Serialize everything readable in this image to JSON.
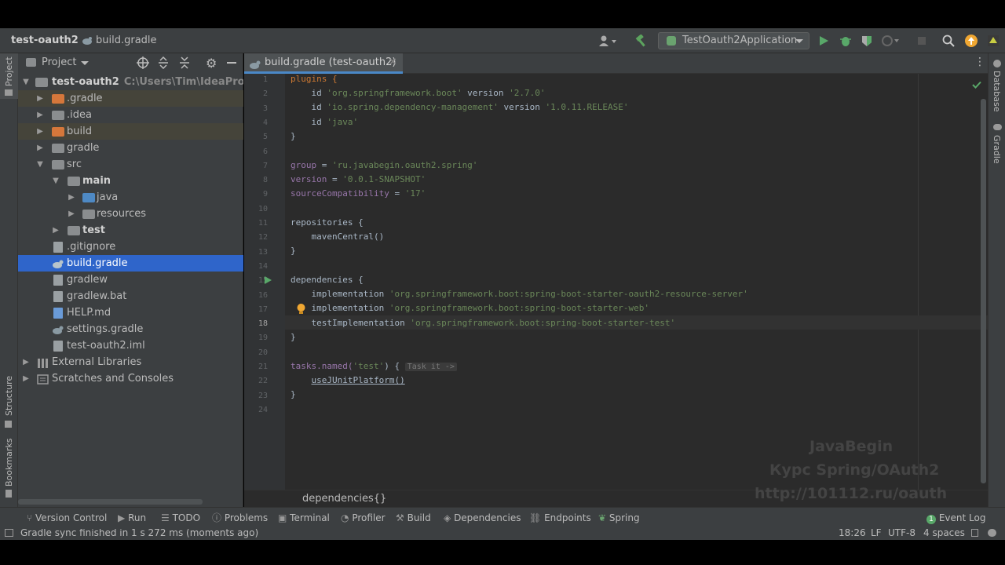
{
  "topbar": {
    "project_name": "test-oauth2",
    "file_breadcrumb": "build.gradle",
    "run_config": "TestOauth2Application"
  },
  "left_strip": {
    "project_tab": "Project",
    "structure_tab": "Structure",
    "bookmarks_tab": "Bookmarks"
  },
  "right_strip": {
    "database_tab": "Database",
    "gradle_tab": "Gradle"
  },
  "project_panel": {
    "view_selector": "Project",
    "root": {
      "label": "test-oauth2",
      "path": "C:\\Users\\Tim\\IdeaProjects\\te"
    },
    "items": [
      {
        "label": ".gradle"
      },
      {
        "label": ".idea"
      },
      {
        "label": "build"
      },
      {
        "label": "gradle"
      },
      {
        "label": "src"
      },
      {
        "label": "main"
      },
      {
        "label": "java"
      },
      {
        "label": "resources"
      },
      {
        "label": "test"
      },
      {
        "label": ".gitignore"
      },
      {
        "label": "build.gradle"
      },
      {
        "label": "gradlew"
      },
      {
        "label": "gradlew.bat"
      },
      {
        "label": "HELP.md"
      },
      {
        "label": "settings.gradle"
      },
      {
        "label": "test-oauth2.iml"
      },
      {
        "label": "External Libraries"
      },
      {
        "label": "Scratches and Consoles"
      }
    ]
  },
  "editor": {
    "tab_label": "build.gradle (test-oauth2)",
    "line_numbers": [
      "1",
      "2",
      "3",
      "4",
      "5",
      "6",
      "7",
      "8",
      "9",
      "10",
      "11",
      "12",
      "13",
      "14",
      "15",
      "16",
      "17",
      "18",
      "19",
      "20",
      "21",
      "22",
      "23",
      "24"
    ],
    "current_line": 18,
    "code": {
      "l1_kw": "plugins {",
      "l2_a": "id ",
      "l2_s": "'org.springframework.boot'",
      "l2_b": " version ",
      "l2_v": "'2.7.0'",
      "l3_a": "id ",
      "l3_s": "'io.spring.dependency-management'",
      "l3_b": " version ",
      "l3_v": "'1.0.11.RELEASE'",
      "l4_a": "id ",
      "l4_s": "'java'",
      "l5": "}",
      "l7_p": "group",
      "l7_e": " = ",
      "l7_s": "'ru.javabegin.oauth2.spring'",
      "l8_p": "version",
      "l8_e": " = ",
      "l8_s": "'0.0.1-SNAPSHOT'",
      "l9_p": "sourceCompatibility",
      "l9_e": " = ",
      "l9_s": "'17'",
      "l11": "repositories {",
      "l12": "mavenCentral()",
      "l13": "}",
      "l15": "dependencies {",
      "l16_a": "implementation ",
      "l16_s": "'org.springframework.boot:spring-boot-starter-oauth2-resource-server'",
      "l17_a": "implementation ",
      "l17_s": "'org.springframework.boot:spring-boot-starter-web'",
      "l18_a": "testImplementation ",
      "l18_s": "'org.springframework.boot:spring-boot-starter-test'",
      "l19": "}",
      "l21_a": "tasks.named(",
      "l21_s": "'test'",
      "l21_b": ") {",
      "l21_hint": "Task it ->",
      "l22": "useJUnitPlatform()",
      "l23": "}"
    },
    "breadcrumb": "dependencies{}"
  },
  "watermark": {
    "line1": "JavaBegin",
    "line2": "Курс Spring/OAuth2",
    "line3": "http://101112.ru/oauth"
  },
  "bottom_tools": {
    "version_control": "Version Control",
    "run": "Run",
    "todo": "TODO",
    "problems": "Problems",
    "terminal": "Terminal",
    "profiler": "Profiler",
    "build": "Build",
    "dependencies": "Dependencies",
    "endpoints": "Endpoints",
    "spring": "Spring",
    "event_log": "Event Log"
  },
  "status": {
    "message": "Gradle sync finished in 1 s 272 ms (moments ago)",
    "position": "18:26",
    "line_sep": "LF",
    "encoding": "UTF-8",
    "indent": "4 spaces"
  },
  "colors": {
    "selection": "#2f65ca",
    "panel": "#3c3f41",
    "editor_bg": "#2b2b2b",
    "keyword": "#cc7832",
    "string": "#6a8759"
  }
}
